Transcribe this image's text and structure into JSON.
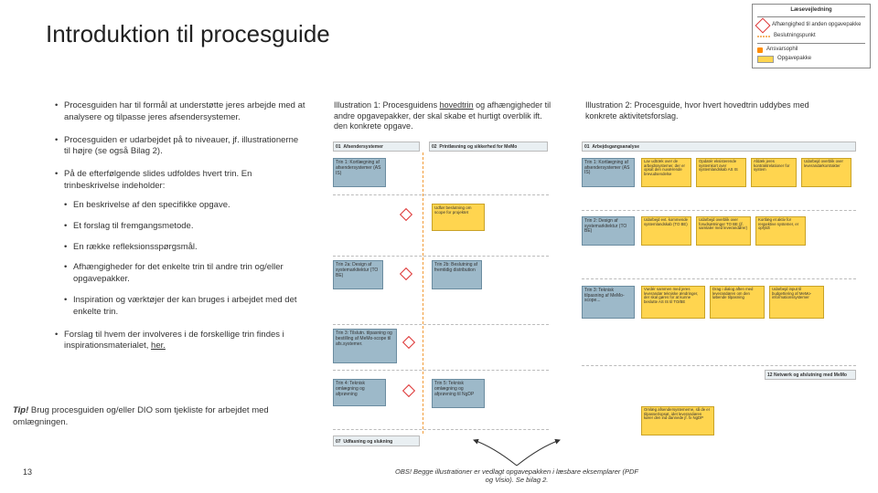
{
  "title": "Introduktion til procesguide",
  "legend": {
    "header": "Læsevejledning",
    "dep": "Afhængighed til anden opgavepakke",
    "decision": "Beslutningspunkt",
    "task": "Opgavepakke",
    "taskid": "Ansvarsophil"
  },
  "left": {
    "b1": "Procesguiden har til formål at understøtte jeres arbejde med at analysere og tilpasse jeres afsendersystemer.",
    "b2": "Procesguiden er udarbejdet på to niveauer, jf. illustrationerne til højre (se også Bilag 2).",
    "b3": "På de efterfølgende slides udfoldes hvert trin. En trinbeskrivelse indeholder:",
    "sub": {
      "s1": "En beskrivelse af den specifikke opgave.",
      "s2": "Et forslag til fremgangsmetode.",
      "s3": "En række refleksionsspørgsmål.",
      "s4": "Afhængigheder for det enkelte trin til andre trin og/eller opgavepakker.",
      "s5": "Inspiration og værktøjer der kan bruges i arbejdet med det enkelte trin."
    },
    "b4_a": "Forslag til hvem der involveres i de forskellige trin findes i inspirationsmaterialet, ",
    "b4_link": "her."
  },
  "tip": {
    "label": "Tip!",
    "text": " Brug procesguiden og/eller DIO som tjekliste for arbejdet med omlægningen."
  },
  "page": "13",
  "cap1_a": "Illustration 1: Procesguidens ",
  "cap1_u": "hovedtrin",
  "cap1_b": " og afhængigheder til andre opgavepakker, der skal skabe et hurtigt overblik ift. den konkrete opgave.",
  "cap2": "Illustration 2: Procesguide, hvor hvert hovedtrin uddybes med konkrete aktivitetsforslag.",
  "ill1": {
    "band01": "01",
    "bandA": "Afsendersystemer",
    "band02": "02",
    "bandB": "Printløsning og sikkerhed for MeMo",
    "t1": "Trin 1: Kortlægning af afsendersystemer (AS IS)",
    "a1": "Udfør beslutning om scope for projektet",
    "t2a": "Trin 2a: Design af systemarkitektur (TO BE)",
    "t2b": "Trin 2b: Beslutning af fremtidig distribution",
    "t3": "Trin 3: Tilslutn. tilpasning og bestilling af MeMo-scope til afs.systemer.",
    "t4": "Trin 4: Teknisk omlægning og afprøvning",
    "t5": "Trin 5: Teknisk omlægning og afprøvning til NgDP",
    "band07": "07",
    "bottom": "Udfasning og slukning"
  },
  "ill2": {
    "band01": "01",
    "bandA": "Arbejdsgangsanalyse",
    "t1": "Trin 1: Kortlægning af afsendersystemer (AS IS)",
    "a11": "Lav udtræk over de arbejdssystemer, der er opsat den nuværende brevudsendelse",
    "a12": "Opdatér eksisterende systemkort over systemlandskab AS IS",
    "a13": "Afdæk jeres kontraktrelationer for system",
    "a14": "Udarbejd overblik over leverandørkontrakter",
    "t2": "Trin 2: Design af systemarkitektur (TO BE)",
    "a21": "Udarbejd evt. kommende systemlandskab (TO BE)",
    "a22": "Udarbejd overblik over forudsætninger TO BE (jf. samtaler med leverandører)",
    "a23": "Kortlæg et aktiv for respektive systemer, er opfyldt",
    "t3": "Trin 3: Teknisk tilpasning af MeMo-scope...",
    "a31": "Vurdér sammen med jeres leverandør tekniske ændringer, der skal gøres for at kunne beslutte AS IS til TO/BE",
    "a32": "Drag i dialog aften med leverandøren om den løbende tilpasning",
    "a33": "Udarbejd input til budgettering af MeMo-informationssystemer",
    "band12": "12",
    "bandB": "Netværk og afslutning med MeMo",
    "a41": "Omlæg afsendersystemerne, så de er tilpasset/opsat, idet leverandøren kører den ind dannede jf. fx NgDP"
  },
  "obs": "OBS! Begge illustrationer er vedlagt opgavepakken i læsbare eksemplarer (PDF og Visio). Se bilag 2."
}
